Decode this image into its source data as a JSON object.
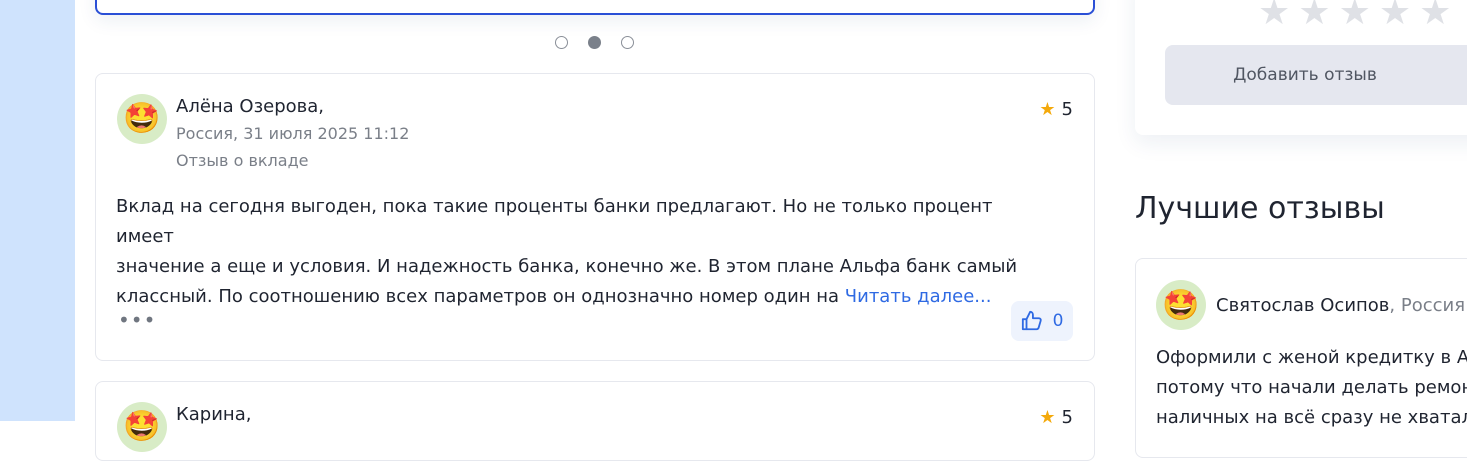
{
  "pagination": {
    "dots": 3,
    "active_index": 1
  },
  "reviews": [
    {
      "avatar_emoji": "🤩",
      "author": "Алёна Озерова,",
      "meta": "Россия, 31 июля 2025 11:12",
      "type": "Отзыв о вкладе",
      "rating": "5",
      "text_line1": "Вклад на сегодня выгоден, пока такие проценты банки предлагают. Но не только процент имеет",
      "text_line2": "значение а еще и условия. И надежность банка, конечно же. В этом плане Альфа банк самый",
      "text_line3": "классный. По соотношению всех параметров он однозначно номер один на ",
      "read_more": "Читать далее...",
      "more": "•••",
      "likes": "0"
    },
    {
      "avatar_emoji": "🤩",
      "author": "Карина,",
      "rating": "5"
    }
  ],
  "sidebar": {
    "stars": [
      "★",
      "★",
      "★",
      "★",
      "★"
    ],
    "add_review_label": "Добавить отзыв",
    "best_title": "Лучшие отзывы",
    "best_review": {
      "avatar_emoji": "🤩",
      "author": "Святослав Осипов",
      "country": ", Россия",
      "text_line1": "Оформили с женой кредитку в Ал",
      "text_line2": "потому что начали делать ремонт",
      "text_line3": "наличных на всё сразу не хватало"
    }
  },
  "colors": {
    "accent": "#2f6ae3",
    "star": "#f4a90b",
    "left_strip": "#cfe3fd"
  }
}
